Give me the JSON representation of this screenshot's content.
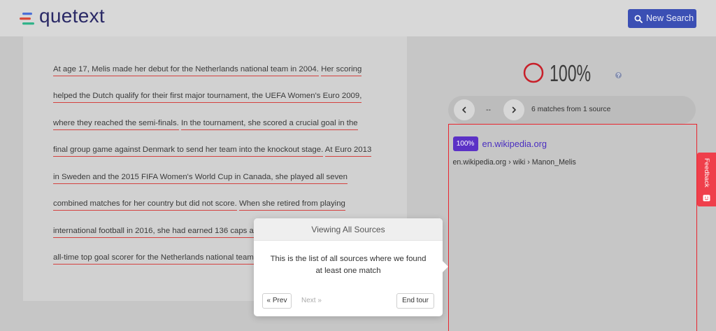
{
  "app": {
    "logo_text": "quetext"
  },
  "header": {
    "new_search_label": "New Search"
  },
  "document": {
    "lines": [
      [
        "At age 17, Melis made her debut for the Netherlands national team in 2004.",
        "Her scoring"
      ],
      [
        "helped the Dutch qualify for their first major tournament, the UEFA Women's Euro 2009,"
      ],
      [
        "where they reached the semi-finals.",
        "In the tournament, she scored a crucial goal in the"
      ],
      [
        "final group game against Denmark to send her team into the knockout stage.",
        "At Euro 2013"
      ],
      [
        "in Sweden and the 2015 FIFA Women's World Cup in Canada, she played all seven"
      ],
      [
        "combined matches for her country but did not score.",
        "When she retired from playing"
      ],
      [
        "international football in 2016, she had earned 136 caps a"
      ],
      [
        "all-time top goal scorer for the Netherlands national team"
      ]
    ]
  },
  "score": {
    "value": 100,
    "label": "100%"
  },
  "match_nav": {
    "position": "--",
    "summary": "6 matches from 1 source"
  },
  "sources": [
    {
      "match_percent": "100%",
      "title": "en.wikipedia.org",
      "path": [
        "en.wikipedia.org",
        "wiki",
        "Manon_Melis"
      ],
      "separator": "›"
    }
  ],
  "feedback": {
    "label": "Feedback"
  },
  "tour": {
    "title": "Viewing All Sources",
    "body": "This is the list of all sources where we found at least one match",
    "prev_label": "« Prev",
    "next_label": "Next »",
    "end_label": "End tour"
  },
  "icons": {
    "logo": "quetext-logo-icon",
    "new_search": "search-icon",
    "help": "question-icon",
    "prev": "chevron-left-icon",
    "next": "chevron-right-icon",
    "feedback": "feedback-face-icon"
  },
  "colors": {
    "brand_navy": "#2a2966",
    "new_search_blue": "#3b4fb4",
    "match_underline": "#d4413f",
    "score_ring": "#c8202a",
    "source_border": "#e8252e",
    "badge_purple": "#5b31c6",
    "link_purple": "#4a2ec0",
    "feedback_red": "#ef3f4b"
  }
}
